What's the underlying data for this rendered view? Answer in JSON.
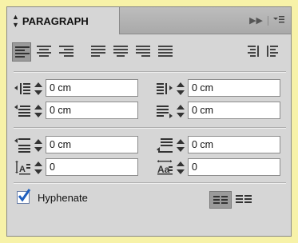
{
  "panel": {
    "title": "PARAGRAPH"
  },
  "indents": {
    "left_indent": "0 cm",
    "right_indent": "0 cm",
    "first_line_indent": "0 cm",
    "last_line_indent": "0 cm"
  },
  "spacing": {
    "space_before": "0 cm",
    "space_after": "0 cm",
    "drop_cap_lines": "0",
    "drop_cap_chars": "0"
  },
  "hyphenate": {
    "label": "Hyphenate",
    "checked": true
  },
  "alignment_buttons": [
    "align-left",
    "align-center",
    "align-right",
    "justify-last-left",
    "justify-last-center",
    "justify-last-right",
    "justify-all",
    "align-towards-spine",
    "align-away-from-spine"
  ],
  "colors": {
    "panel_bg": "#d6d6d6",
    "selected_button": "#9a9a9a",
    "checkbox_check": "#1f5fbf",
    "page_bg": "#f7f2a8"
  }
}
